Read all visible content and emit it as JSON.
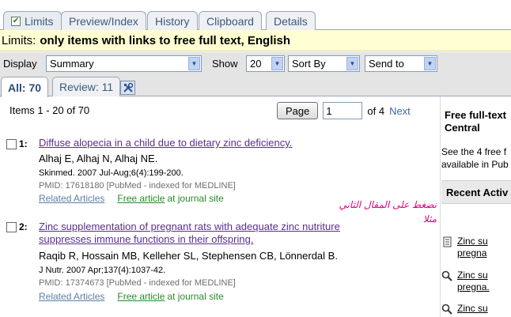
{
  "tabs": [
    {
      "label": "Limits",
      "checked": true
    },
    {
      "label": "Preview/Index"
    },
    {
      "label": "History"
    },
    {
      "label": "Clipboard"
    },
    {
      "label": "Details"
    }
  ],
  "limits": {
    "label": "Limits:",
    "value": "only items with links to free full text, English"
  },
  "controls": {
    "display_label": "Display",
    "display_value": "Summary",
    "show_label": "Show",
    "show_value": "20",
    "sort_value": "Sort By",
    "send_value": "Send to"
  },
  "subtabs": [
    {
      "label": "All: 70",
      "active": true
    },
    {
      "label": "Review: 11"
    }
  ],
  "results": {
    "items_text": "Items 1 - 20 of 70",
    "page_button": "Page",
    "page_value": "1",
    "of_text": "of 4",
    "next_label": "Next"
  },
  "records": [
    {
      "num": "1:",
      "title": "Diffuse alopecia in a child due to dietary zinc deficiency.",
      "authors": "Alhaj E, Alhaj N, Alhaj NE.",
      "source": "Skinmed. 2007 Jul-Aug;6(4):199-200.",
      "pmid": "PMID: 17618180 [PubMed - indexed for MEDLINE]",
      "related": "Related Articles",
      "free": "Free article",
      "site": "at journal site"
    },
    {
      "num": "2:",
      "title": "Zinc supplementation of pregnant rats with adequate zinc nutriture suppresses immune functions in their offspring.",
      "authors": "Raqib R, Hossain MB, Kelleher SL, Stephensen CB, Lönnerdal B.",
      "source": "J Nutr. 2007 Apr;137(4):1037-42.",
      "pmid": "PMID: 17374673 [PubMed - indexed for MEDLINE]",
      "related": "Related Articles",
      "free": "Free article",
      "site": "at journal site"
    }
  ],
  "annotation": {
    "line1": "نضغط على المقال الثاني",
    "line2": "مثلا"
  },
  "sidebar": {
    "heading_line1": "Free full-text",
    "heading_line2": "Central",
    "text_line1": "See the 4 free f",
    "text_line2": "available in Pub",
    "recent_heading": "Recent Activ",
    "recent_items": [
      {
        "line1": "Zinc su",
        "line2": "pregna",
        "icon": "document-icon"
      },
      {
        "line1": "Zinc su",
        "line2": "pregna.",
        "icon": "magnifier-icon"
      },
      {
        "line1": "Zinc su",
        "line2": "",
        "icon": "magnifier-icon"
      }
    ]
  },
  "colors": {
    "limits_bg": "#fffdd2",
    "link_visited": "#5a2e91",
    "free_green": "#2a8a2a",
    "annotation_pink": "#e6007a"
  }
}
